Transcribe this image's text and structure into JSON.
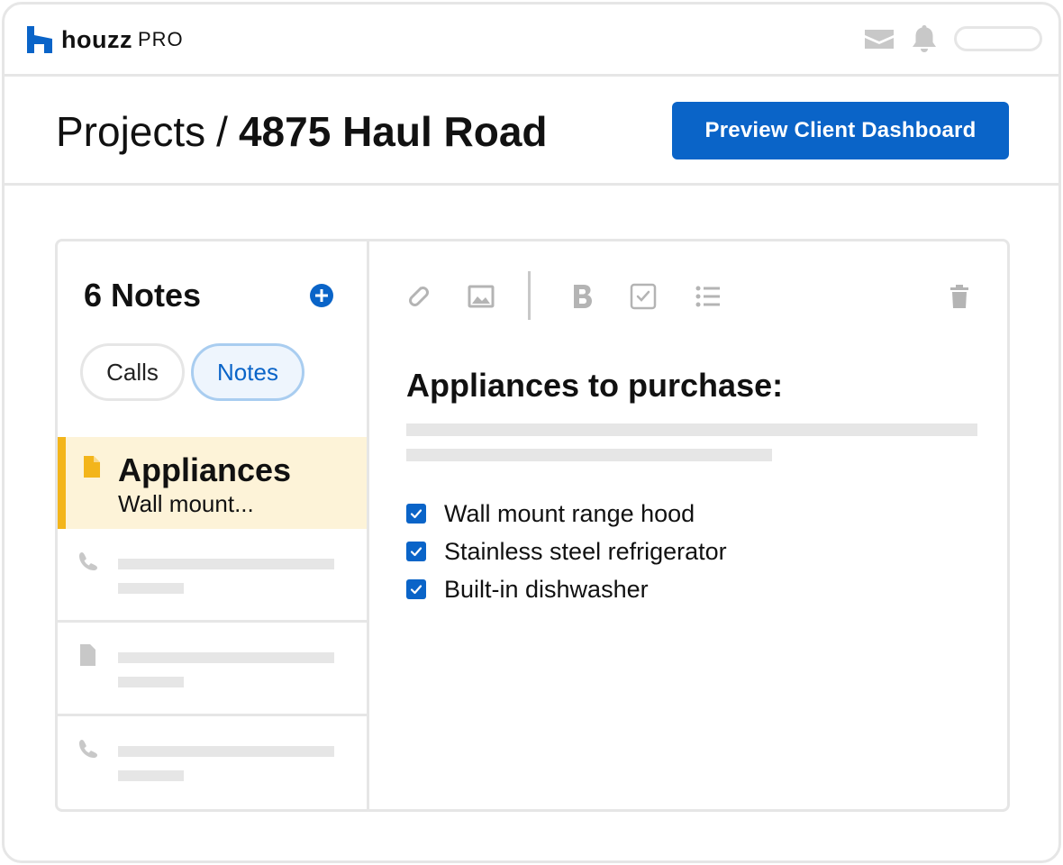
{
  "header": {
    "brand": "houzz",
    "brand_suffix": "PRO"
  },
  "titlebar": {
    "section": "Projects",
    "separator": "/",
    "project": "4875 Haul Road",
    "preview_button": "Preview Client Dashboard"
  },
  "sidebar": {
    "count_label": "6 Notes",
    "filters": [
      "Calls",
      "Notes"
    ],
    "active_filter": "Notes",
    "active_note": {
      "title": "Appliances",
      "snippet": "Wall mount..."
    }
  },
  "editor": {
    "heading": "Appliances to purchase:",
    "checklist": [
      {
        "label": "Wall mount range hood",
        "checked": true
      },
      {
        "label": "Stainless steel refrigerator",
        "checked": true
      },
      {
        "label": "Built-in dishwasher",
        "checked": true
      }
    ]
  },
  "colors": {
    "accent": "#0a64c8",
    "highlight": "#fdf3d8",
    "highlight_border": "#f3b51b"
  }
}
